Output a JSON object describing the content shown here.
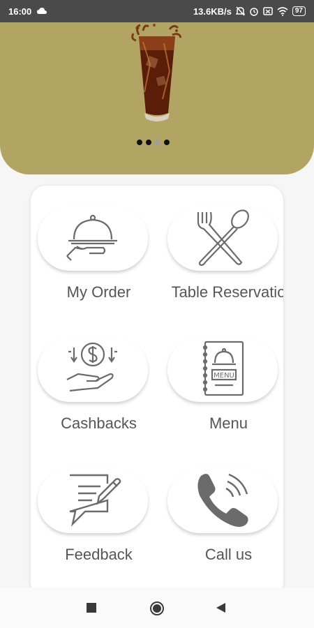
{
  "status_bar": {
    "time": "16:00",
    "network_speed": "13.6KB/s",
    "battery": "97"
  },
  "banner": {
    "carousel_total": 4,
    "carousel_active": 3
  },
  "tiles": [
    {
      "label": "My Order",
      "icon": "food-tray-icon"
    },
    {
      "label": "Table Reservatio",
      "icon": "fork-spoon-icon"
    },
    {
      "label": "Cashbacks",
      "icon": "cashback-hand-icon"
    },
    {
      "label": "Menu",
      "icon": "menu-book-icon"
    },
    {
      "label": "Feedback",
      "icon": "feedback-icon"
    },
    {
      "label": "Call us",
      "icon": "phone-icon"
    }
  ],
  "colors": {
    "banner": "#b2a563",
    "status_bar": "#4a4a4a",
    "icon_stroke": "#6b6b6b"
  }
}
